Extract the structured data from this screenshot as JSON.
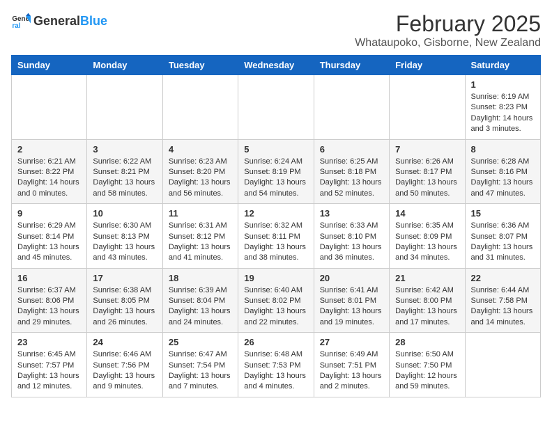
{
  "header": {
    "logo_general": "General",
    "logo_blue": "Blue",
    "month": "February 2025",
    "location": "Whataupoko, Gisborne, New Zealand"
  },
  "days_of_week": [
    "Sunday",
    "Monday",
    "Tuesday",
    "Wednesday",
    "Thursday",
    "Friday",
    "Saturday"
  ],
  "weeks": [
    [
      {
        "day": "",
        "info": ""
      },
      {
        "day": "",
        "info": ""
      },
      {
        "day": "",
        "info": ""
      },
      {
        "day": "",
        "info": ""
      },
      {
        "day": "",
        "info": ""
      },
      {
        "day": "",
        "info": ""
      },
      {
        "day": "1",
        "info": "Sunrise: 6:19 AM\nSunset: 8:23 PM\nDaylight: 14 hours and 3 minutes."
      }
    ],
    [
      {
        "day": "2",
        "info": "Sunrise: 6:21 AM\nSunset: 8:22 PM\nDaylight: 14 hours and 0 minutes."
      },
      {
        "day": "3",
        "info": "Sunrise: 6:22 AM\nSunset: 8:21 PM\nDaylight: 13 hours and 58 minutes."
      },
      {
        "day": "4",
        "info": "Sunrise: 6:23 AM\nSunset: 8:20 PM\nDaylight: 13 hours and 56 minutes."
      },
      {
        "day": "5",
        "info": "Sunrise: 6:24 AM\nSunset: 8:19 PM\nDaylight: 13 hours and 54 minutes."
      },
      {
        "day": "6",
        "info": "Sunrise: 6:25 AM\nSunset: 8:18 PM\nDaylight: 13 hours and 52 minutes."
      },
      {
        "day": "7",
        "info": "Sunrise: 6:26 AM\nSunset: 8:17 PM\nDaylight: 13 hours and 50 minutes."
      },
      {
        "day": "8",
        "info": "Sunrise: 6:28 AM\nSunset: 8:16 PM\nDaylight: 13 hours and 47 minutes."
      }
    ],
    [
      {
        "day": "9",
        "info": "Sunrise: 6:29 AM\nSunset: 8:14 PM\nDaylight: 13 hours and 45 minutes."
      },
      {
        "day": "10",
        "info": "Sunrise: 6:30 AM\nSunset: 8:13 PM\nDaylight: 13 hours and 43 minutes."
      },
      {
        "day": "11",
        "info": "Sunrise: 6:31 AM\nSunset: 8:12 PM\nDaylight: 13 hours and 41 minutes."
      },
      {
        "day": "12",
        "info": "Sunrise: 6:32 AM\nSunset: 8:11 PM\nDaylight: 13 hours and 38 minutes."
      },
      {
        "day": "13",
        "info": "Sunrise: 6:33 AM\nSunset: 8:10 PM\nDaylight: 13 hours and 36 minutes."
      },
      {
        "day": "14",
        "info": "Sunrise: 6:35 AM\nSunset: 8:09 PM\nDaylight: 13 hours and 34 minutes."
      },
      {
        "day": "15",
        "info": "Sunrise: 6:36 AM\nSunset: 8:07 PM\nDaylight: 13 hours and 31 minutes."
      }
    ],
    [
      {
        "day": "16",
        "info": "Sunrise: 6:37 AM\nSunset: 8:06 PM\nDaylight: 13 hours and 29 minutes."
      },
      {
        "day": "17",
        "info": "Sunrise: 6:38 AM\nSunset: 8:05 PM\nDaylight: 13 hours and 26 minutes."
      },
      {
        "day": "18",
        "info": "Sunrise: 6:39 AM\nSunset: 8:04 PM\nDaylight: 13 hours and 24 minutes."
      },
      {
        "day": "19",
        "info": "Sunrise: 6:40 AM\nSunset: 8:02 PM\nDaylight: 13 hours and 22 minutes."
      },
      {
        "day": "20",
        "info": "Sunrise: 6:41 AM\nSunset: 8:01 PM\nDaylight: 13 hours and 19 minutes."
      },
      {
        "day": "21",
        "info": "Sunrise: 6:42 AM\nSunset: 8:00 PM\nDaylight: 13 hours and 17 minutes."
      },
      {
        "day": "22",
        "info": "Sunrise: 6:44 AM\nSunset: 7:58 PM\nDaylight: 13 hours and 14 minutes."
      }
    ],
    [
      {
        "day": "23",
        "info": "Sunrise: 6:45 AM\nSunset: 7:57 PM\nDaylight: 13 hours and 12 minutes."
      },
      {
        "day": "24",
        "info": "Sunrise: 6:46 AM\nSunset: 7:56 PM\nDaylight: 13 hours and 9 minutes."
      },
      {
        "day": "25",
        "info": "Sunrise: 6:47 AM\nSunset: 7:54 PM\nDaylight: 13 hours and 7 minutes."
      },
      {
        "day": "26",
        "info": "Sunrise: 6:48 AM\nSunset: 7:53 PM\nDaylight: 13 hours and 4 minutes."
      },
      {
        "day": "27",
        "info": "Sunrise: 6:49 AM\nSunset: 7:51 PM\nDaylight: 13 hours and 2 minutes."
      },
      {
        "day": "28",
        "info": "Sunrise: 6:50 AM\nSunset: 7:50 PM\nDaylight: 12 hours and 59 minutes."
      },
      {
        "day": "",
        "info": ""
      }
    ]
  ]
}
